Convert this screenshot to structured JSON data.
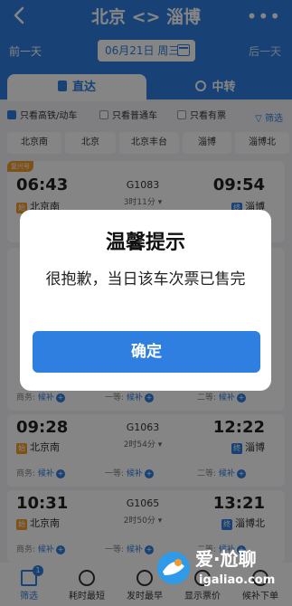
{
  "header": {
    "back_icon": "chevron-left-icon",
    "title": "北京 <> 淄博",
    "more_icon": "more-dots-icon",
    "prev_day": "前一天",
    "next_day": "后一天",
    "date": "06月21日 周三",
    "calendar_icon": "calendar-icon"
  },
  "tabs": [
    {
      "label": "直达",
      "icon": "train-icon",
      "active": true
    },
    {
      "label": "中转",
      "icon": "transfer-icon",
      "active": false
    }
  ],
  "filters": {
    "items": [
      {
        "label": "只看高铁/动车",
        "checked": true
      },
      {
        "label": "只看普通车",
        "checked": false
      },
      {
        "label": "只看有票",
        "checked": false
      }
    ],
    "filter_button": "筛选"
  },
  "stations": [
    "北京南",
    "北京",
    "北京丰台",
    "淄博",
    "淄博北"
  ],
  "trains": [
    {
      "badge": "复兴号",
      "dep_time": "06:43",
      "train_no": "G1083",
      "duration": "3时11分",
      "arr_time": "09:54",
      "dep_station": "北京南",
      "dep_tag": "始",
      "arr_station": "淄博",
      "arr_tag": "终"
    },
    {
      "badge": "",
      "dep_time": "",
      "train_no": "",
      "duration": "",
      "arr_time": "",
      "dep_station": "",
      "dep_tag": "",
      "arr_station": "",
      "arr_tag": "",
      "seats": [
        {
          "class": "商务",
          "status": "候补"
        },
        {
          "class": "一等",
          "status": "候补"
        },
        {
          "class": "二等",
          "status": "候补"
        }
      ]
    },
    {
      "badge": "",
      "dep_time": "09:28",
      "train_no": "G1063",
      "duration": "2时54分",
      "arr_time": "12:22",
      "dep_station": "北京南",
      "dep_tag": "始",
      "arr_station": "淄博",
      "arr_tag": "终",
      "seats": [
        {
          "class": "商务",
          "status": "候补"
        },
        {
          "class": "一等",
          "status": "候补"
        },
        {
          "class": "二等",
          "status": "候补"
        }
      ]
    },
    {
      "badge": "",
      "dep_time": "10:31",
      "train_no": "G1065",
      "duration": "2时50分",
      "arr_time": "13:21",
      "dep_station": "北京南",
      "dep_tag": "始",
      "arr_station": "淄博北",
      "arr_tag": "终",
      "seats": [
        {
          "class": "商务",
          "status": "候补"
        },
        {
          "class": "一等",
          "status": "候补"
        },
        {
          "class": "二等",
          "status": "候补"
        }
      ]
    }
  ],
  "dialog": {
    "title": "温馨提示",
    "message": "很抱歉，当日该车次票已售完",
    "ok_button": "确定"
  },
  "bottom_bar": [
    {
      "label": "筛选",
      "icon": "filter-icon",
      "badge": "1",
      "active": true
    },
    {
      "label": "耗时最短",
      "icon": "clock-icon",
      "active": false
    },
    {
      "label": "发时最早",
      "icon": "24h-icon",
      "active": false
    },
    {
      "label": "显示票价",
      "icon": "price-icon",
      "active": false
    },
    {
      "label": "候补下单",
      "icon": "waitlist-icon",
      "active": false
    }
  ],
  "watermark": {
    "text": "爱·尬聊",
    "url": "igaliao.com"
  },
  "colors": {
    "primary": "#2f7fe0",
    "badge_orange": "#f29b2e",
    "overlay": "rgba(0,0,0,0.48)"
  }
}
